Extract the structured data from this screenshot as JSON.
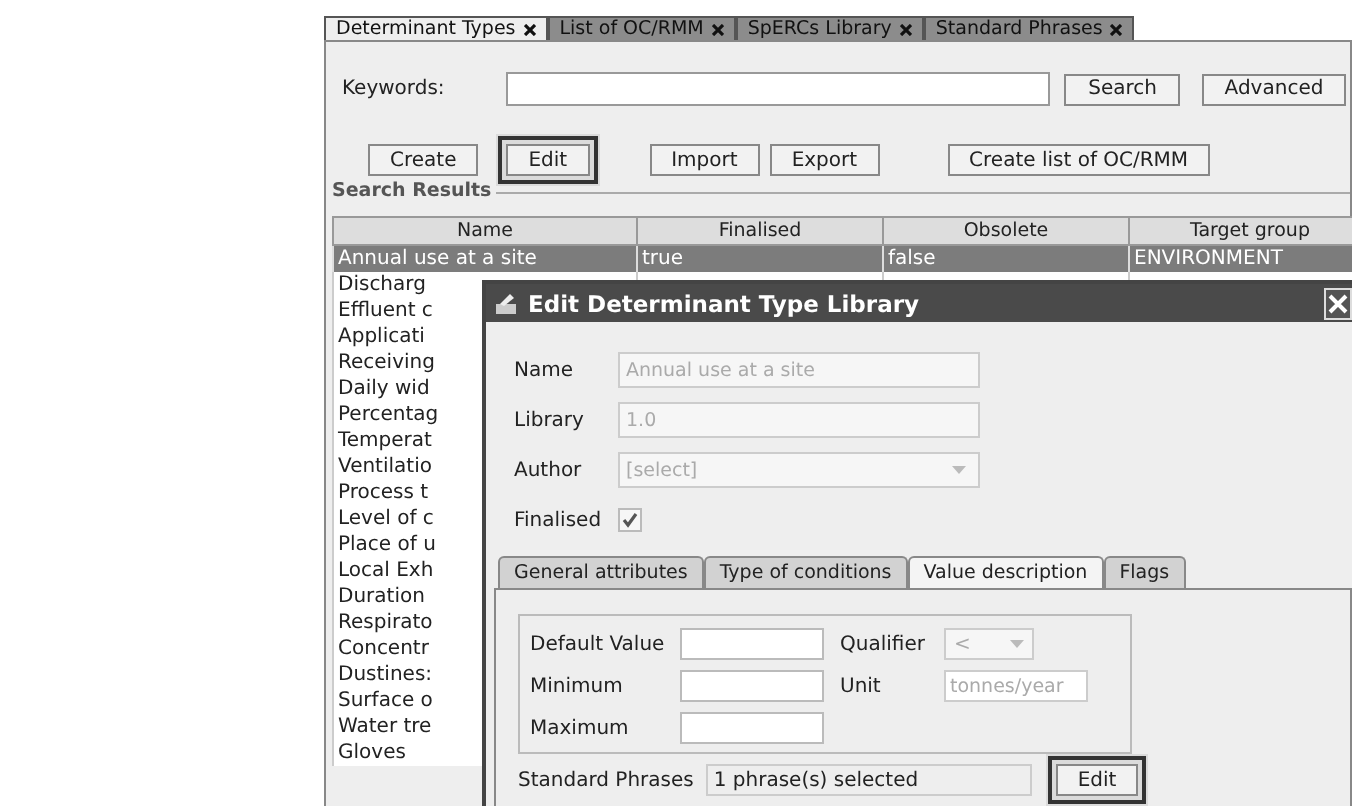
{
  "tabs": [
    {
      "label": "Determinant Types",
      "selected": true
    },
    {
      "label": "List of OC/RMM",
      "selected": false
    },
    {
      "label": "SpERCs Library",
      "selected": false
    },
    {
      "label": "Standard Phrases",
      "selected": false
    }
  ],
  "search": {
    "label": "Keywords:",
    "button": "Search",
    "advanced_button": "Advanced"
  },
  "toolbar": [
    {
      "label": "Create",
      "highlighted": false
    },
    {
      "label": "Edit",
      "highlighted": true
    },
    {
      "label": "Import",
      "highlighted": false
    },
    {
      "label": "Export",
      "highlighted": false
    },
    {
      "label": "Create list of OC/RMM",
      "highlighted": false
    }
  ],
  "results": {
    "title": "Search Results",
    "columns": [
      "Name",
      "Finalised",
      "Obsolete",
      "Target group"
    ],
    "rows": [
      {
        "cells": [
          "Annual use at a site",
          "true",
          "false",
          "ENVIRONMENT"
        ],
        "selected": true
      },
      {
        "cells": [
          "Discharg"
        ],
        "selected": false
      },
      {
        "cells": [
          "Effluent c"
        ],
        "selected": false
      },
      {
        "cells": [
          "Applicati"
        ],
        "selected": false
      },
      {
        "cells": [
          "Receiving"
        ],
        "selected": false
      },
      {
        "cells": [
          "Daily wid"
        ],
        "selected": false
      },
      {
        "cells": [
          "Percentag"
        ],
        "selected": false
      },
      {
        "cells": [
          "Temperat"
        ],
        "selected": false
      },
      {
        "cells": [
          "Ventilatio"
        ],
        "selected": false
      },
      {
        "cells": [
          "Process t"
        ],
        "selected": false
      },
      {
        "cells": [
          "Level of c"
        ],
        "selected": false
      },
      {
        "cells": [
          "Place of u"
        ],
        "selected": false
      },
      {
        "cells": [
          "Local Exh"
        ],
        "selected": false
      },
      {
        "cells": [
          "Duration"
        ],
        "selected": false
      },
      {
        "cells": [
          "Respirato"
        ],
        "selected": false
      },
      {
        "cells": [
          "Concentr"
        ],
        "selected": false
      },
      {
        "cells": [
          "Dustines:"
        ],
        "selected": false
      },
      {
        "cells": [
          "Surface o"
        ],
        "selected": false
      },
      {
        "cells": [
          "Water tre"
        ],
        "selected": false
      },
      {
        "cells": [
          "Gloves"
        ],
        "selected": false
      }
    ]
  },
  "dialog": {
    "title": "Edit Determinant Type Library",
    "fields": [
      {
        "label": "Name",
        "kind": "text",
        "value": "Annual use at a site",
        "disabled": true
      },
      {
        "label": "Library",
        "kind": "text",
        "value": "1.0",
        "disabled": true
      },
      {
        "label": "Author",
        "kind": "select",
        "value": "[select]",
        "disabled": true
      },
      {
        "label": "Finalised",
        "kind": "checkbox",
        "checked": true,
        "disabled": true
      }
    ],
    "tabs": [
      {
        "label": "General attributes",
        "selected": false
      },
      {
        "label": "Type of conditions",
        "selected": false
      },
      {
        "label": "Value description",
        "selected": true
      },
      {
        "label": "Flags",
        "selected": false
      }
    ],
    "value_fields": [
      {
        "label": "Default Value"
      },
      {
        "label": "Minimum"
      },
      {
        "label": "Maximum"
      }
    ],
    "qualifier": {
      "label": "Qualifier",
      "value": "<",
      "disabled": true
    },
    "unit": {
      "label": "Unit",
      "value": "tonnes/year",
      "disabled": true
    },
    "phrases": {
      "label": "Standard Phrases",
      "value": "1 phrase(s) selected",
      "button": {
        "label": "Edit",
        "highlighted": true
      }
    }
  }
}
